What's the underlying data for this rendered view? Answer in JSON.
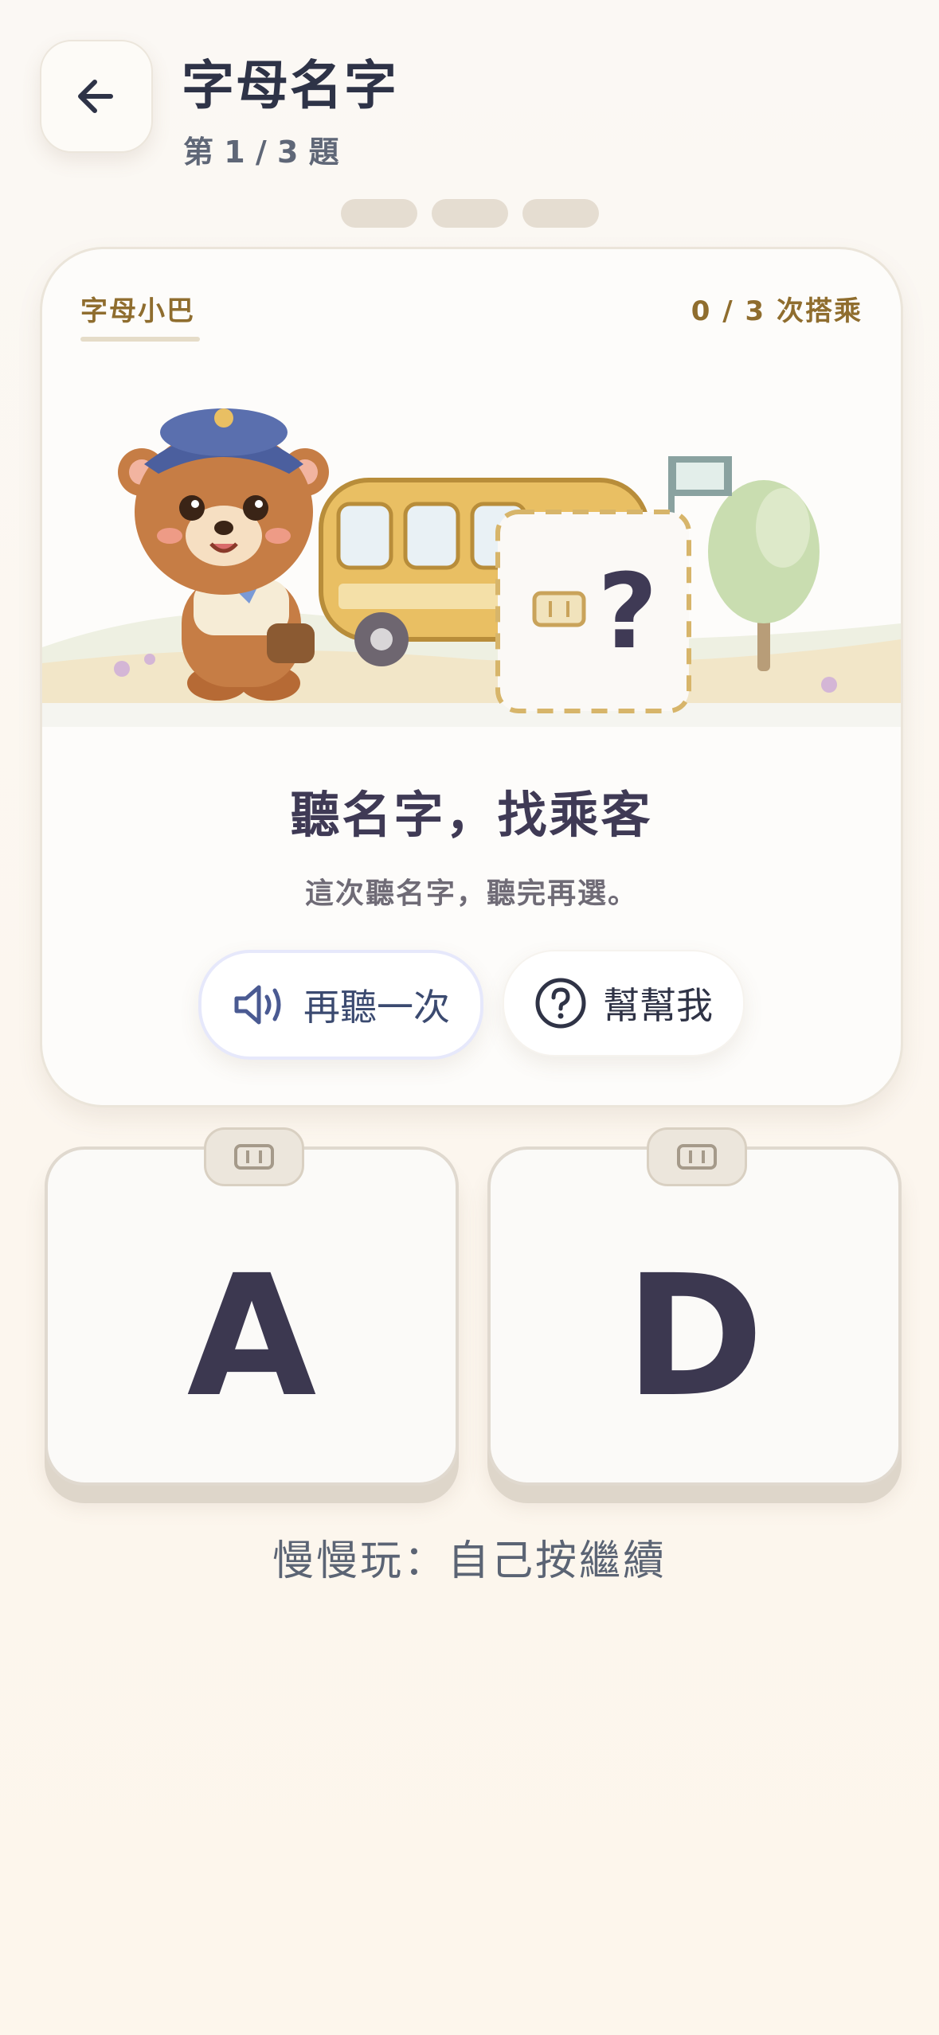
{
  "header": {
    "title": "字母名字",
    "subtitle": "第 1 / 3 題",
    "progress_steps": 3
  },
  "card": {
    "label": "字母小巴",
    "count": "0 / 3 次搭乘",
    "slot_mark": "?",
    "prompt": "聽名字，找乘客",
    "hint": "這次聽名字，聽完再選。",
    "replay_label": "再聽一次",
    "help_label": "幫幫我"
  },
  "choices": [
    {
      "letter": "A"
    },
    {
      "letter": "D"
    }
  ],
  "footer": {
    "mode_note": "慢慢玩：自己按繼續"
  },
  "colors": {
    "accent": "#8f6d2e",
    "text_dark": "#3f3a55",
    "bus": "#e9bf63",
    "tree": "#c9ddb0"
  }
}
